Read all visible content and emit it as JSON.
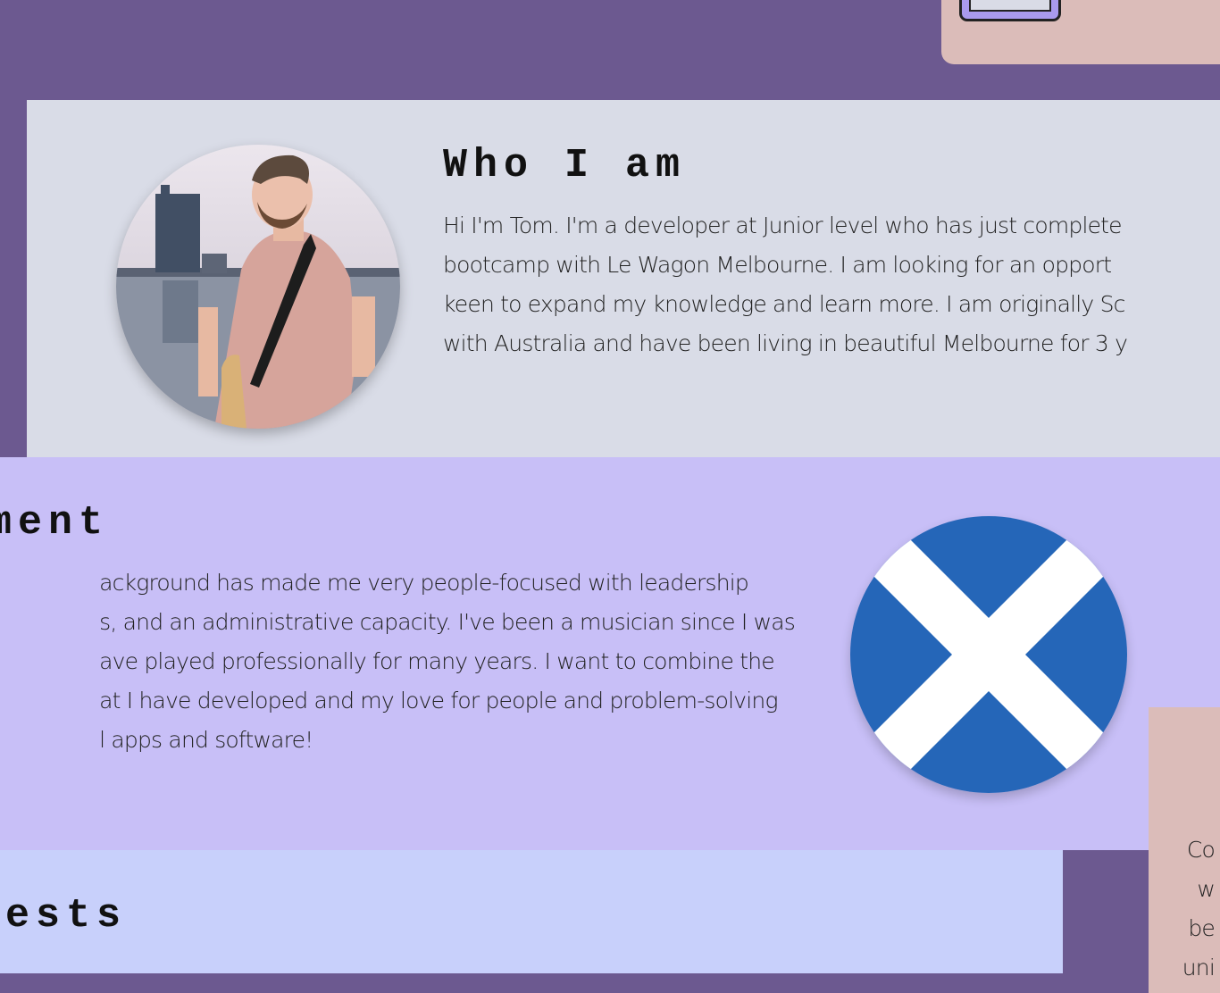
{
  "about": {
    "heading": "Who I am",
    "lines": [
      "Hi I'm Tom. I'm a developer at Junior level who has just complete",
      "bootcamp with Le Wagon Melbourne. I am looking for an opport",
      "keen to expand my knowledge and learn more. I am originally Sc",
      "with Australia and have been living in beautiful Melbourne for 3 y"
    ]
  },
  "environment": {
    "heading": "ment",
    "lines": [
      "ackground has made me very people-focused with leadership",
      "s, and an administrative capacity. I've been a musician since I was",
      "ave played professionally for many years. I want to combine the",
      "at I have developed and my love for people and problem-solving",
      "l apps and software!"
    ]
  },
  "interests": {
    "heading": "rests"
  },
  "side_card": {
    "lines": [
      "Co",
      "w",
      "be",
      "uni"
    ]
  },
  "colors": {
    "page_bg": "#6c5990",
    "about_bg": "#d9dce7",
    "environment_bg": "#c8bff7",
    "interests_bg": "#c8d0fb",
    "card_bg": "#dbbcb9",
    "flag_blue": "#2566b8"
  },
  "images": {
    "avatar": "profile-photo",
    "flag": "scotland-flag"
  }
}
